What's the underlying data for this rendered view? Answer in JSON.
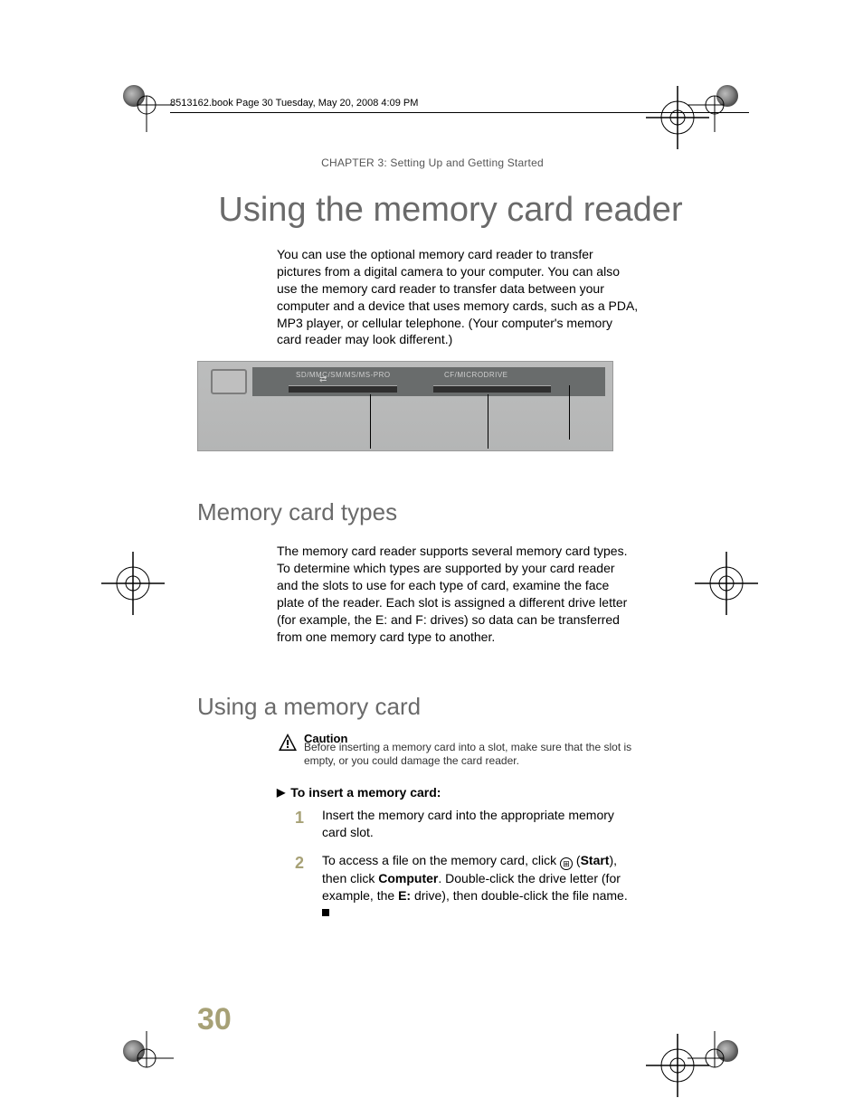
{
  "running_head": "8513162.book  Page 30  Tuesday, May 20, 2008  4:09 PM",
  "chapter_line": "CHAPTER 3: Setting Up and Getting Started",
  "title": "Using the memory card reader",
  "intro": "You can use the optional memory card reader to transfer pictures from a digital camera to your computer. You can also use the memory card reader to transfer data between your computer and a device that uses memory cards, such as a PDA, MP3 player, or cellular telephone. (Your computer's memory card reader may look different.)",
  "figure": {
    "slot1_label": "SD/MMC/SM/MS/MS-PRO",
    "slot2_label": "CF/MICRODRIVE"
  },
  "sec1": {
    "head": "Memory card types",
    "body": "The memory card reader supports several memory card types. To determine which types are supported by your card reader and the slots to use for each type of card, examine the face plate of the reader. Each slot is assigned a different drive letter (for example, the E: and F: drives) so data can be transferred from one memory card type to another."
  },
  "sec2": {
    "head": "Using a memory card",
    "caution_title": "Caution",
    "caution_text": "Before inserting a memory card into a slot, make sure that the slot is empty, or you could damage the card reader.",
    "task_head": "To insert a memory card:",
    "steps": {
      "s1": "Insert the memory card into the appropriate memory card slot.",
      "s2a": "To access a file on the memory card, click ",
      "s2b": " (",
      "s2_bold1": "Start",
      "s2c": "), then click ",
      "s2_bold2": "Computer",
      "s2d": ". Double-click the drive letter (for example, the ",
      "s2_bold3": "E:",
      "s2e": " drive), then double-click the file name."
    }
  },
  "page_number": "30"
}
